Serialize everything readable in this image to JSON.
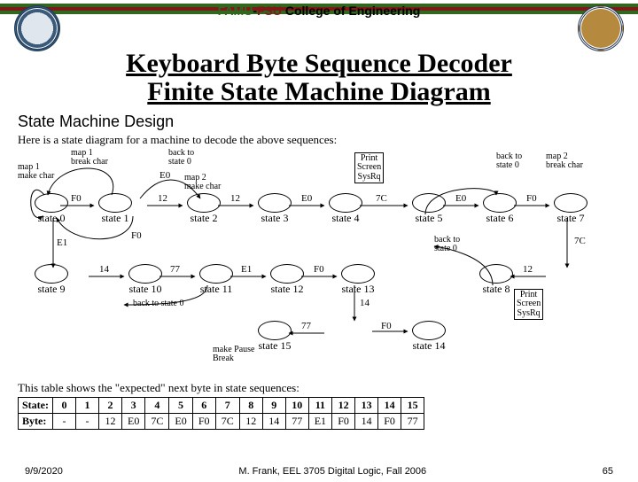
{
  "header": {
    "famu": "FAMU",
    "dash": "-",
    "fsu": "FSU",
    "rest": " College of Engineering"
  },
  "title_line1": "Keyboard Byte Sequence Decoder",
  "title_line2": "Finite State Machine Diagram",
  "subtitle": "State Machine Design",
  "desc": "Here is a state diagram for a machine to decode the above sequences:",
  "notes": {
    "map1": "map 1\nmake char",
    "map1break": "map 1\nbreak char",
    "map2make": "map 2\nmake char",
    "map2break": "map 2\nbreak char",
    "back0a": "back to\nstate 0",
    "back0b": "back to\nstate 0",
    "back0c": "back to state 0",
    "back0d": "back to\nstate 0",
    "prtscr": "Print\nScreen\nSysRq",
    "prtscr2": "Print\nScreen\nSysRq",
    "pause": "make Pause\nBreak"
  },
  "states": {
    "s0": "state\n0",
    "s1": "state\n1",
    "s2": "state\n2",
    "s3": "state\n3",
    "s4": "state\n4",
    "s5": "state\n5",
    "s6": "state\n6",
    "s7": "state\n7",
    "s8": "state\n8",
    "s9": "state\n9",
    "s10": "state\n10",
    "s11": "state\n11",
    "s12": "state\n12",
    "s13": "state\n13",
    "s14": "state\n14",
    "s15": "state\n15"
  },
  "edges": {
    "e0_1": "F0",
    "e1_back": "",
    "e0_2": "E0",
    "e2_3": "12",
    "e3_4": "E0",
    "e4_5": "7C",
    "e5_6": "E0",
    "e6_7": "F0",
    "e7_8": "7C",
    "e8_12": "12",
    "e0_9": "E1",
    "e2_0": "F0",
    "e2_back": "",
    "e9_10": "14",
    "e10_11": "77",
    "e11_12a": "E1",
    "e12_13": "F0",
    "e13_14": "14",
    "e14_15": "F0",
    "e15_14": "77"
  },
  "desc2": "This table shows the \"expected\" next byte in state sequences:",
  "table": {
    "header_label": "State:",
    "row_label": "Byte:",
    "states": [
      "0",
      "1",
      "2",
      "3",
      "4",
      "5",
      "6",
      "7",
      "8",
      "9",
      "10",
      "11",
      "12",
      "13",
      "14",
      "15"
    ],
    "bytes": [
      "-",
      "-",
      "12",
      "E0",
      "7C",
      "E0",
      "F0",
      "7C",
      "12",
      "14",
      "77",
      "E1",
      "F0",
      "14",
      "F0",
      "77"
    ]
  },
  "footer": {
    "date": "9/9/2020",
    "credit": "M. Frank, EEL 3705 Digital Logic, Fall 2006",
    "page": "65"
  }
}
